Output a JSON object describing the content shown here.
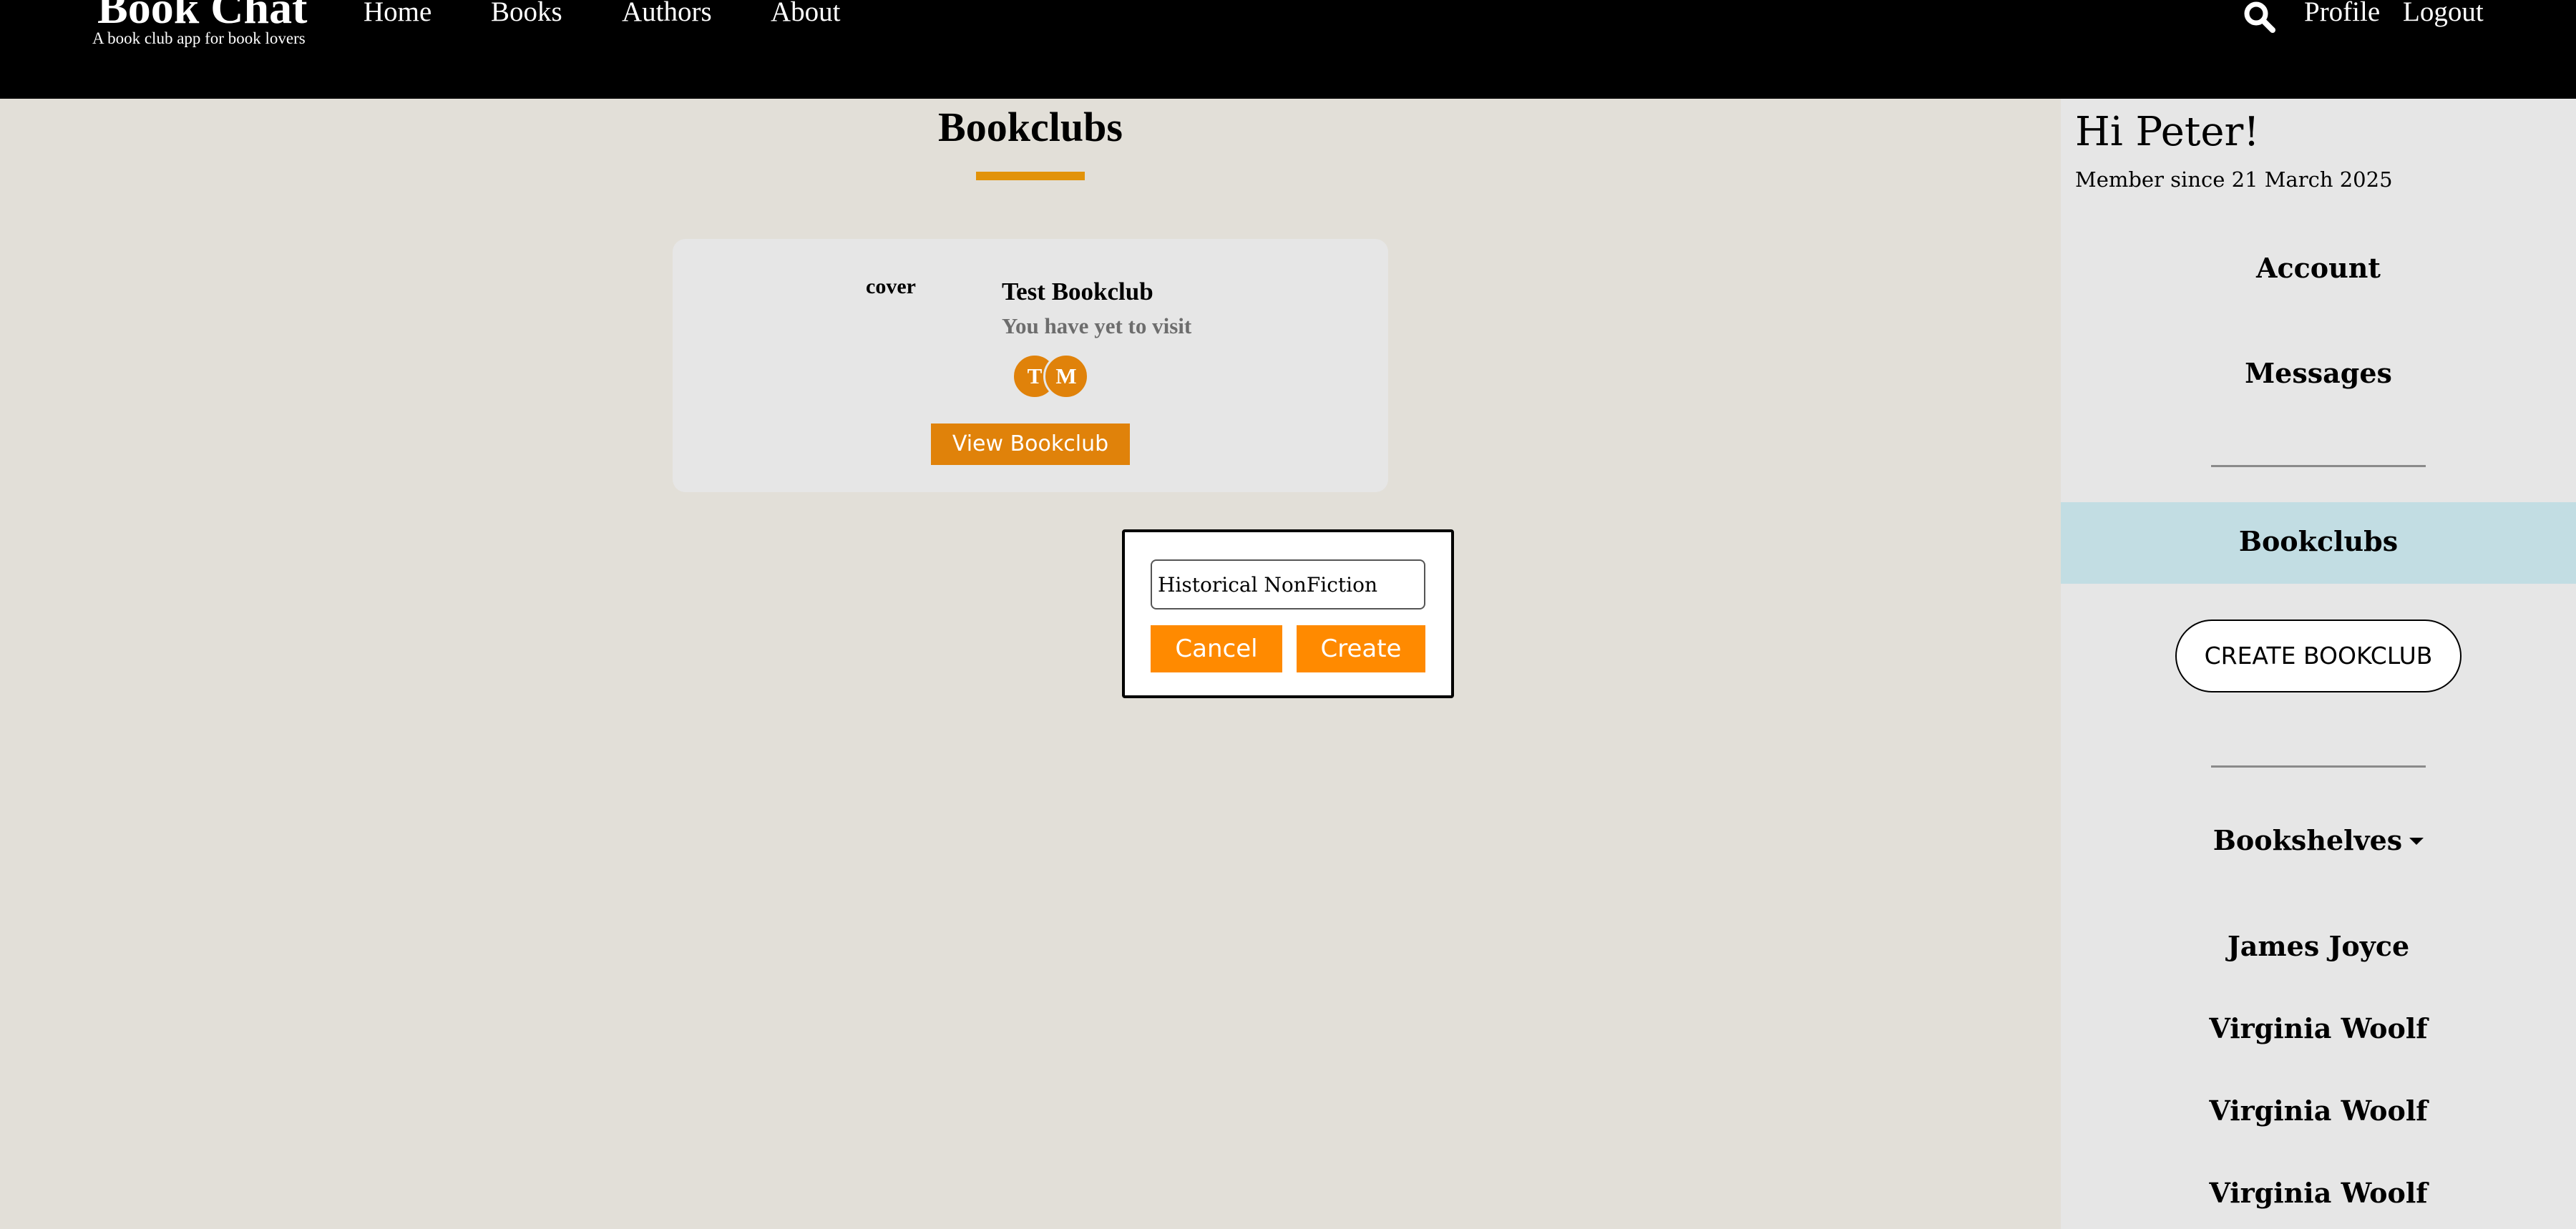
{
  "header": {
    "brand_title": "Book Chat",
    "brand_subtitle": "A book club app for book lovers",
    "nav": [
      "Home",
      "Books",
      "Authors",
      "About"
    ],
    "search_icon": "search-icon",
    "profile_label": "Profile",
    "logout_label": "Logout"
  },
  "main": {
    "title": "Bookclubs",
    "accent_color": "#e2930a",
    "card": {
      "cover_label": "cover",
      "name": "Test Bookclub",
      "status": "You have yet to visit",
      "members": [
        "T",
        "M"
      ],
      "view_label": "View Bookclub"
    }
  },
  "modal": {
    "input_value": "Historical NonFiction",
    "cancel_label": "Cancel",
    "create_label": "Create",
    "button_color": "#ff8a00"
  },
  "sidebar": {
    "greeting": "Hi Peter!",
    "member_since": "Member since 21 March 2025",
    "account_label": "Account",
    "messages_label": "Messages",
    "bookclubs_label": "Bookclubs",
    "create_bookclub_label": "CREATE BOOKCLUB",
    "bookshelves_label": "Bookshelves",
    "shelves": [
      "James Joyce",
      "Virginia Woolf",
      "Virginia Woolf",
      "Virginia Woolf"
    ],
    "active_color": "#c2dde3"
  }
}
